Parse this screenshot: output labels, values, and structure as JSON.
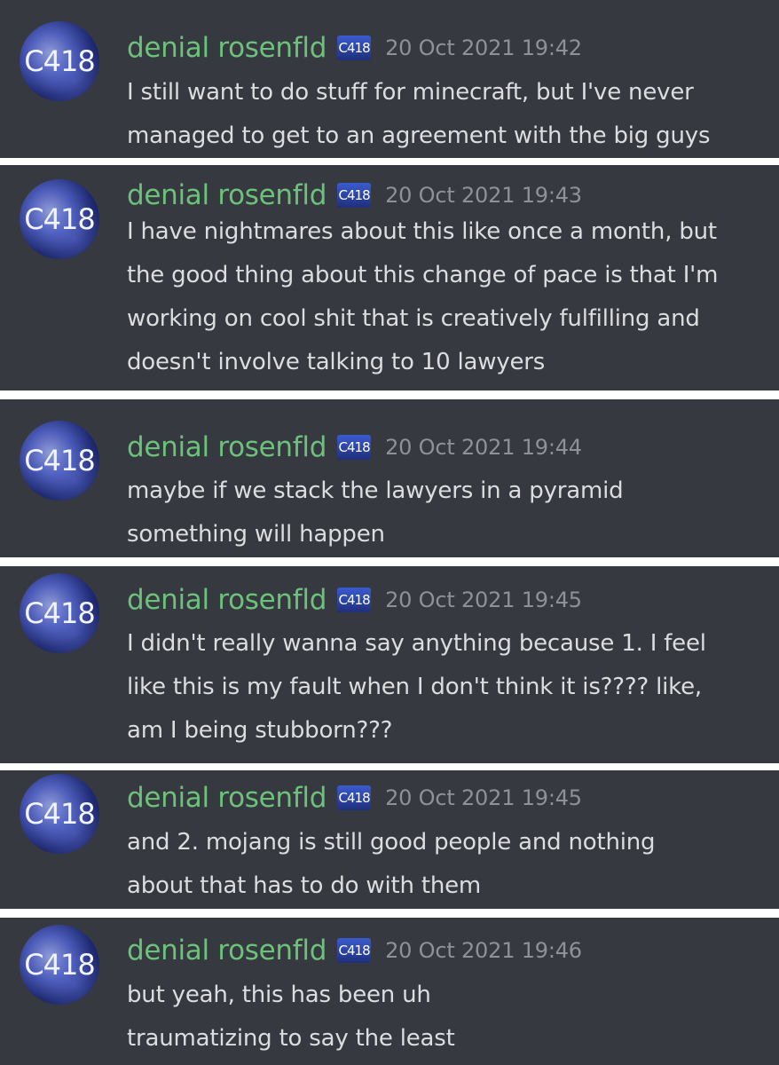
{
  "author": {
    "name": "denial rosenfld",
    "avatar_text": "C418",
    "badge_text": "C418"
  },
  "messages": [
    {
      "timestamp": "20 Oct 2021 19:42",
      "lines": [
        "I still want to do stuff for minecraft, but I've never",
        "managed to get to an agreement with the big guys"
      ]
    },
    {
      "timestamp": "20 Oct 2021 19:43",
      "lines": [
        "I have nightmares about this like once a month, but",
        "the good thing about this change of pace is that I'm",
        "working on cool shit that is creatively fulfilling and",
        "doesn't involve talking to 10 lawyers"
      ]
    },
    {
      "timestamp": "20 Oct 2021 19:44",
      "lines": [
        "maybe if we stack the lawyers in a pyramid",
        "something will happen"
      ]
    },
    {
      "timestamp": "20 Oct 2021 19:45",
      "lines": [
        "I didn't really wanna say anything because 1. I feel",
        "like this is my fault when I don't think it is???? like,",
        "am I being stubborn???"
      ]
    },
    {
      "timestamp": "20 Oct 2021 19:45",
      "lines": [
        "and 2. mojang is still good people and nothing",
        "about that has to do with them"
      ]
    },
    {
      "timestamp": "20 Oct 2021 19:46",
      "lines": [
        "but yeah, this has been uh",
        "traumatizing to say the least"
      ]
    }
  ],
  "colors": {
    "panel_background": "#36393f",
    "separator": "#ffffff",
    "username": "#6cc27a",
    "timestamp": "#8e9297",
    "message_text": "#dcddde"
  }
}
